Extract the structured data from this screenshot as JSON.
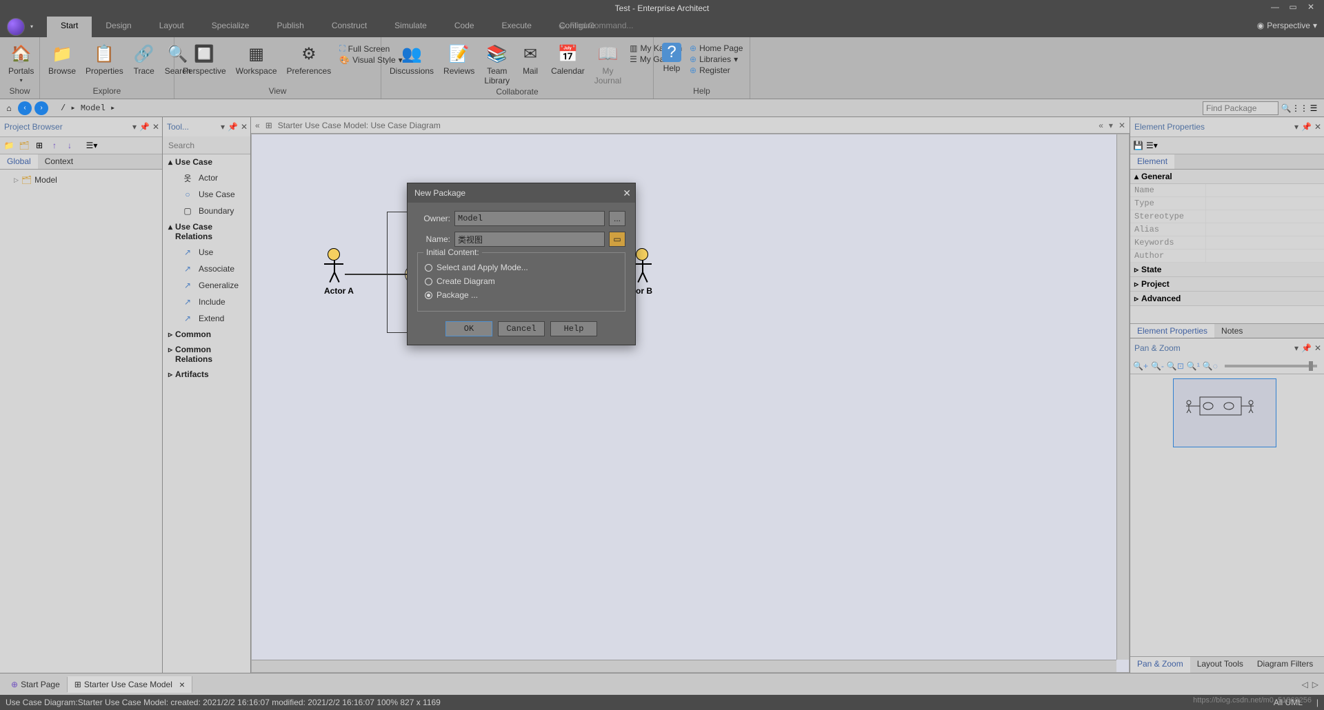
{
  "title": "Test - Enterprise Architect",
  "menu": {
    "items": [
      "Start",
      "Design",
      "Layout",
      "Specialize",
      "Publish",
      "Construct",
      "Simulate",
      "Code",
      "Execute",
      "Configure"
    ],
    "active": "Start",
    "find_placeholder": "Find Command...",
    "perspective": "Perspective"
  },
  "ribbon": {
    "groups": {
      "show": {
        "label": "Show",
        "portals": "Portals"
      },
      "explore": {
        "label": "Explore",
        "browse": "Browse",
        "properties": "Properties",
        "trace": "Trace",
        "search": "Search"
      },
      "view": {
        "label": "View",
        "perspective": "Perspective",
        "workspace": "Workspace",
        "preferences": "Preferences",
        "full_screen": "Full Screen",
        "visual_style": "Visual Style"
      },
      "collab": {
        "label": "Collaborate",
        "discussions": "Discussions",
        "reviews": "Reviews",
        "team_library": "Team\nLibrary",
        "mail": "Mail",
        "calendar": "Calendar",
        "my_journal": "My\nJournal",
        "my_kanban": "My Kanban",
        "my_gantt": "My Gantt"
      },
      "help": {
        "label": "Help",
        "help": "Help",
        "home": "Home Page",
        "libraries": "Libraries",
        "register": "Register"
      }
    }
  },
  "nav": {
    "back": "‹",
    "fwd": "›",
    "crumbs": "/  ▸ Model ▸",
    "find_placeholder": "Find Package"
  },
  "project_browser": {
    "title": "Project Browser",
    "tabs": [
      "Global",
      "Context"
    ],
    "active_tab": "Global",
    "tree": {
      "root": "Model"
    }
  },
  "toolbox": {
    "title": "Tool...",
    "search_placeholder": "Search",
    "sections": [
      {
        "name": "Use Case",
        "expanded": true,
        "items": [
          "Actor",
          "Use Case",
          "Boundary"
        ]
      },
      {
        "name": "Use Case Relations",
        "expanded": true,
        "items": [
          "Use",
          "Associate",
          "Generalize",
          "Include",
          "Extend"
        ]
      },
      {
        "name": "Common",
        "expanded": false,
        "items": []
      },
      {
        "name": "Common Relations",
        "expanded": false,
        "items": []
      },
      {
        "name": "Artifacts",
        "expanded": false,
        "items": []
      }
    ]
  },
  "diagram": {
    "breadcrumb": "Starter Use Case Model:  Use Case Diagram",
    "actor_a": "Actor A",
    "actor_b": "tor B",
    "tabs": [
      {
        "name": "Start Page",
        "close": false
      },
      {
        "name": "Starter Use Case Model",
        "close": true
      }
    ],
    "active_tab": 1
  },
  "properties": {
    "title": "Element Properties",
    "header_tab": "Element",
    "sections": {
      "general": {
        "name": "General",
        "expanded": true,
        "rows": [
          "Name",
          "Type",
          "Stereotype",
          "Alias",
          "Keywords",
          "Author"
        ]
      },
      "state": "State",
      "project": "Project",
      "advanced": "Advanced"
    },
    "bottom_tabs": [
      "Element Properties",
      "Notes"
    ],
    "active_bottom": 0
  },
  "pan_zoom": {
    "title": "Pan & Zoom"
  },
  "right_bottom_tabs": [
    "Pan & Zoom",
    "Layout Tools",
    "Diagram Filters"
  ],
  "status": {
    "left": "Use Case Diagram:Starter Use Case Model:   created: 2021/2/2 16:16:07   modified: 2021/2/2 16:16:07   100%   827 x 1169",
    "uml": "All UML",
    "watermark": "https://blog.csdn.net/m0_51868256"
  },
  "dialog": {
    "title": "New Package",
    "owner_label": "Owner:",
    "owner_value": "Model",
    "name_label": "Name:",
    "name_value": "类视图",
    "fieldset_legend": "Initial Content:",
    "radios": [
      "Select and Apply Mode...",
      "Create Diagram",
      "Package ..."
    ],
    "selected_radio": 2,
    "ok": "OK",
    "cancel": "Cancel",
    "help": "Help"
  }
}
